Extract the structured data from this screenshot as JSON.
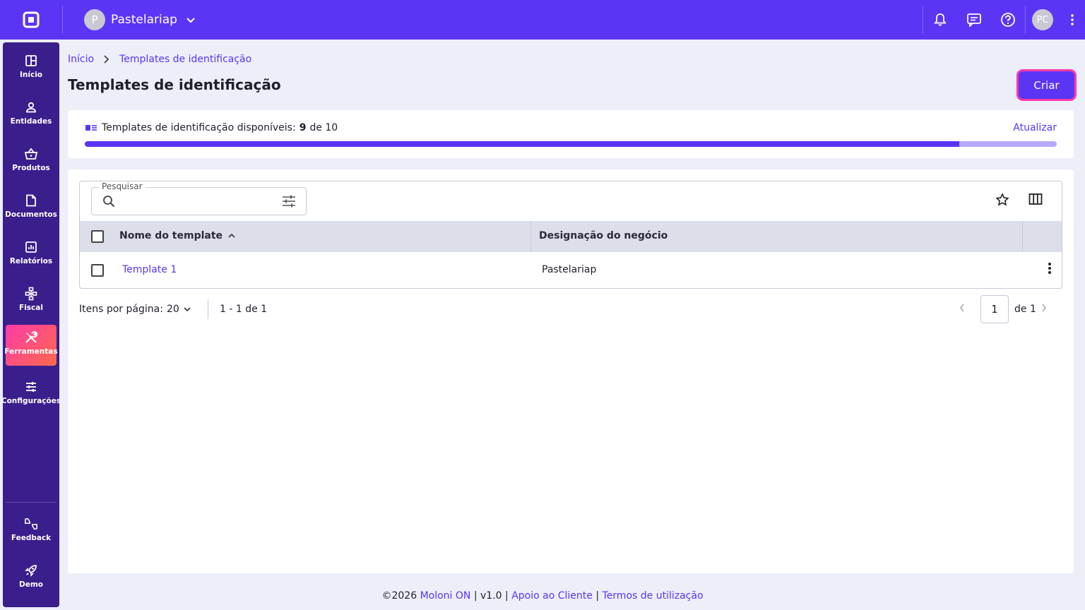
{
  "topbar": {
    "company_initial": "P",
    "company_name": "Pastelariap",
    "user_initials": "PC"
  },
  "sidebar": {
    "items": [
      {
        "label": "Início",
        "icon": "dashboard-icon"
      },
      {
        "label": "Entidades",
        "icon": "person-icon"
      },
      {
        "label": "Produtos",
        "icon": "basket-icon"
      },
      {
        "label": "Documentos",
        "icon": "document-icon"
      },
      {
        "label": "Relatórios",
        "icon": "report-icon"
      },
      {
        "label": "Fiscal",
        "icon": "fiscal-icon"
      },
      {
        "label": "Ferramentas",
        "icon": "tools-icon",
        "active": true
      },
      {
        "label": "Configurações",
        "icon": "sliders-icon"
      }
    ],
    "bottom_items": [
      {
        "label": "Feedback",
        "icon": "feedback-icon"
      },
      {
        "label": "Demo",
        "icon": "rocket-icon"
      }
    ]
  },
  "breadcrumb": {
    "home": "Início",
    "current": "Templates de identificação"
  },
  "page": {
    "title": "Templates de identificação",
    "create_label": "Criar"
  },
  "quota": {
    "label": "Templates de identificação disponíveis:",
    "used": "9",
    "of_text": "de 10",
    "refresh_label": "Atualizar",
    "progress": 0.9
  },
  "table": {
    "search_label": "Pesquisar",
    "search_value": "",
    "columns": [
      "Nome do template",
      "Designação do negócio"
    ],
    "rows": [
      {
        "name": "Template 1",
        "business": "Pastelariap"
      }
    ]
  },
  "pagination": {
    "per_page_label": "Itens por página:",
    "per_page": "20",
    "range": "1 - 1 de 1",
    "current_page": "1",
    "of_pages": "de 1"
  },
  "footer": {
    "copyright": "©2026",
    "brand": "Moloni ON",
    "version": "v1.0",
    "support": "Apoio ao Cliente",
    "terms": "Termos de utilização"
  },
  "colors": {
    "primary": "#5b35f5",
    "sidebar": "#3a1e8c",
    "active_gradient_start": "#ff3aa8",
    "active_gradient_end": "#ff6a4a",
    "background": "#eceef8"
  }
}
